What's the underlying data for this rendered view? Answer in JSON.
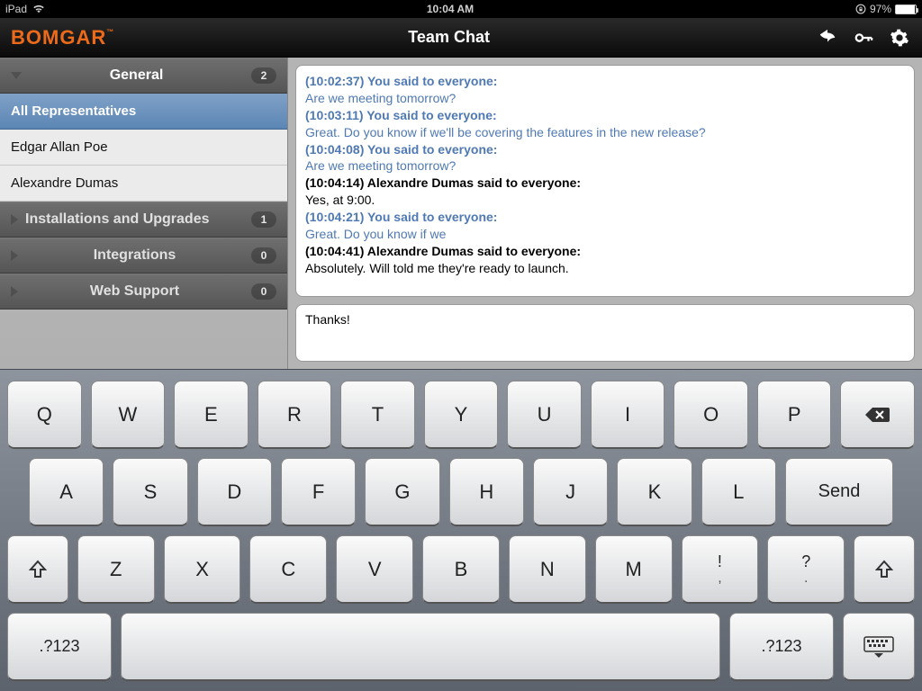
{
  "status": {
    "device": "iPad",
    "time": "10:04 AM",
    "battery_pct": "97%"
  },
  "nav": {
    "brand": "BOMGAR",
    "title": "Team Chat"
  },
  "sidebar": {
    "sections": [
      {
        "label": "General",
        "badge": "2",
        "expanded": true
      },
      {
        "label": "Installations and Upgrades",
        "badge": "1",
        "expanded": false
      },
      {
        "label": "Integrations",
        "badge": "0",
        "expanded": false
      },
      {
        "label": "Web Support",
        "badge": "0",
        "expanded": false
      }
    ],
    "general_items": [
      {
        "label": "All Representatives",
        "active": true
      },
      {
        "label": "Edgar Allan Poe",
        "active": false
      },
      {
        "label": "Alexandre Dumas",
        "active": false
      }
    ]
  },
  "chat": {
    "messages": [
      {
        "kind": "self",
        "header": "(10:02:37) You said to everyone:",
        "body": "Are we meeting tomorrow?"
      },
      {
        "kind": "self",
        "header": "(10:03:11) You said to everyone:",
        "body": "Great. Do you know if we'll be covering the features in the new release?"
      },
      {
        "kind": "self",
        "header": "(10:04:08) You said to everyone:",
        "body": "Are we meeting tomorrow?"
      },
      {
        "kind": "other",
        "header": "(10:04:14) Alexandre Dumas said to everyone:",
        "body": "Yes, at 9:00."
      },
      {
        "kind": "self",
        "header": "(10:04:21) You said to everyone:",
        "body": "Great. Do you know if we"
      },
      {
        "kind": "other",
        "header": "(10:04:41) Alexandre Dumas said to everyone:",
        "body": "Absolutely. Will told me they're ready to launch."
      }
    ],
    "input_value": "Thanks!"
  },
  "keyboard": {
    "row1": [
      "Q",
      "W",
      "E",
      "R",
      "T",
      "Y",
      "U",
      "I",
      "O",
      "P"
    ],
    "row2": [
      "A",
      "S",
      "D",
      "F",
      "G",
      "H",
      "J",
      "K",
      "L"
    ],
    "row3": [
      "Z",
      "X",
      "C",
      "V",
      "B",
      "N",
      "M"
    ],
    "punct1": {
      "top": "!",
      "bot": ","
    },
    "punct2": {
      "top": "?",
      "bot": "."
    },
    "send": "Send",
    "mode": ".?123"
  }
}
